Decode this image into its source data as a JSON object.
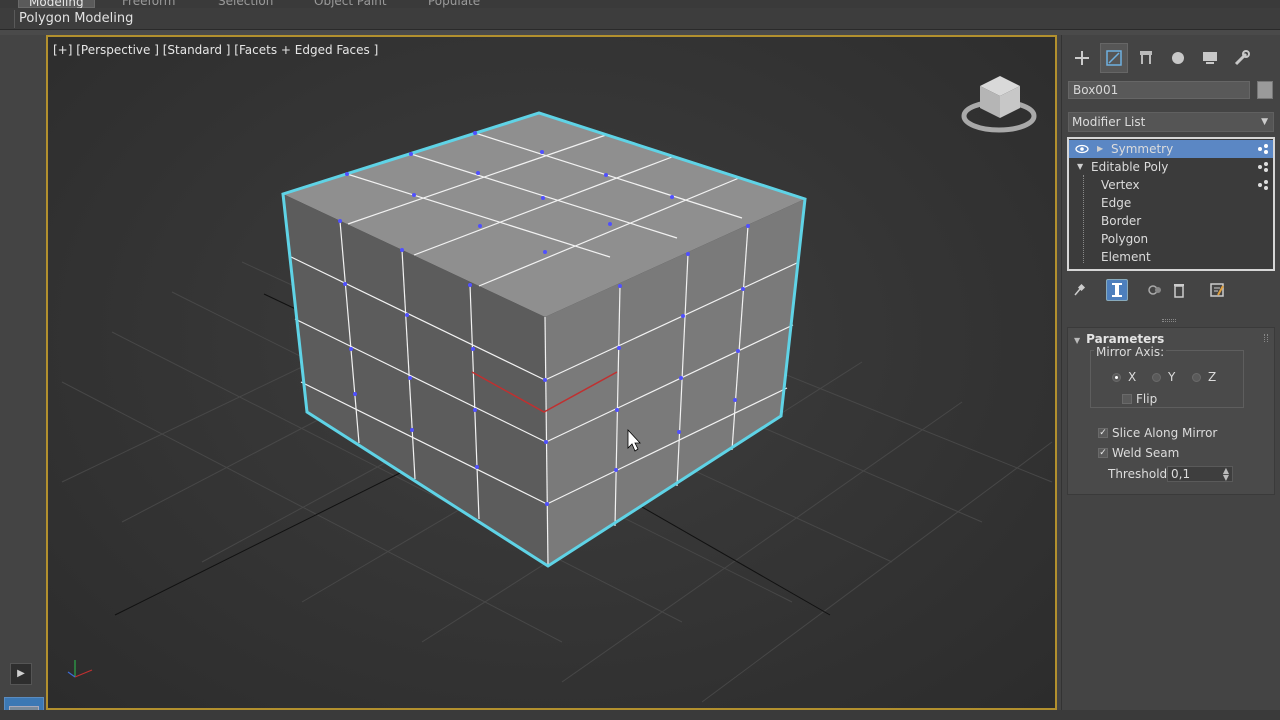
{
  "ribbon": {
    "tabs": [
      {
        "label": "Modeling",
        "active": true
      },
      {
        "label": "Freeform",
        "active": false
      },
      {
        "label": "Selection",
        "active": false
      },
      {
        "label": "Object Paint",
        "active": false
      },
      {
        "label": "Populate",
        "active": false
      }
    ],
    "panel_title": "Polygon Modeling"
  },
  "viewport": {
    "label": "[+] [Perspective ] [Standard ] [Facets + Edged Faces ]",
    "viewcube_icon": "viewcube-icon",
    "axis_tripod_icon": "axis-tripod-icon",
    "selection_color": "#5fd3e6",
    "vertex_color": "#5050ff",
    "highlight_edge_color": "#c03030",
    "border_color": "#b2902e"
  },
  "command_panel": {
    "tabs": [
      {
        "icon": "create-icon",
        "active": false
      },
      {
        "icon": "modify-icon",
        "active": true
      },
      {
        "icon": "hierarchy-icon",
        "active": false
      },
      {
        "icon": "motion-icon",
        "active": false
      },
      {
        "icon": "display-icon",
        "active": false
      },
      {
        "icon": "utilities-icon",
        "active": false
      }
    ],
    "object_name": "Box001",
    "object_color": "#9a9a9a",
    "modifier_list_label": "Modifier List",
    "stack": {
      "symmetry": "Symmetry",
      "editable_poly": "Editable Poly",
      "sub_objects": [
        "Vertex",
        "Edge",
        "Border",
        "Polygon",
        "Element"
      ]
    },
    "stack_tools": [
      "pin-stack-icon",
      "show-end-result-icon",
      "make-unique-icon",
      "remove-modifier-icon",
      "configure-modifier-sets-icon"
    ],
    "parameters": {
      "title": "Parameters",
      "mirror_axis_label": "Mirror Axis:",
      "axes": [
        {
          "label": "X",
          "selected": true
        },
        {
          "label": "Y",
          "selected": false
        },
        {
          "label": "Z",
          "selected": false
        }
      ],
      "flip": {
        "label": "Flip",
        "checked": false
      },
      "slice_along_mirror": {
        "label": "Slice Along Mirror",
        "checked": true
      },
      "weld_seam": {
        "label": "Weld Seam",
        "checked": true
      },
      "threshold": {
        "label": "Threshold:",
        "value": "0,1"
      }
    }
  },
  "left_strip": {
    "play_icon": "play-icon",
    "layer_icon": "layer-explorer-icon"
  }
}
